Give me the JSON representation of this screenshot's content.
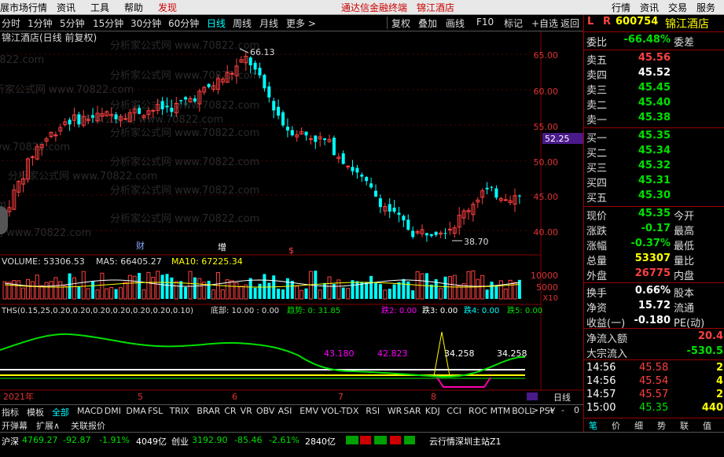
{
  "menubar": {
    "items": [
      "展市场行情",
      "资讯",
      "工具",
      "帮助",
      "发现"
    ],
    "center_red": "通达信金融终端",
    "center_stock": "锦江酒店",
    "right": [
      "行情",
      "资讯",
      "交易",
      "服务"
    ]
  },
  "periods": {
    "items": [
      "分时",
      "1分钟",
      "5分钟",
      "15分钟",
      "30分钟",
      "60分钟",
      "日线",
      "周线",
      "月线",
      "更多 >"
    ],
    "active": "日线"
  },
  "toolbar": {
    "items": [
      "复权",
      "叠加",
      "画线",
      "F10",
      "标记",
      "+自选",
      "返回"
    ]
  },
  "main": {
    "title": "锦江酒店(日线 前复权)",
    "price_axis": [
      "65.00",
      "60.00",
      "55.00",
      "50.00",
      "45.00",
      "40.00"
    ],
    "current_tag": "52.25",
    "high_label": "66.13",
    "low_label": "38.70",
    "events": [
      "财",
      "增",
      "$"
    ],
    "watermark": "分析家公式网 www.70822.com"
  },
  "volume": {
    "label": "VOLUME: 53306.53",
    "ma5": "MA5: 66405.27",
    "ma10": "MA10: 67225.34",
    "axis": [
      "10000",
      "5000"
    ],
    "x10": "X10"
  },
  "ths": {
    "label": "THS(0.15,25,0.20,0.20,0.20,0.20,0.20,0.20,0.10)",
    "bottom": "底部: 10.00 : 0.00",
    "trend": "趋势: 0: 31.85",
    "fall2": "跌2: 0.00",
    "fall3": "跌3: 0.00",
    "fall4": "跌4: 0.00",
    "fall5": "跌5: 0.00",
    "values": [
      "43.180",
      "42.823",
      "34.258",
      "34.258"
    ]
  },
  "timeaxis": {
    "labels": [
      "2021年",
      "5",
      "6",
      "7",
      "8"
    ],
    "period": "日线"
  },
  "tabs": {
    "items": [
      "指标",
      "模板",
      "全部",
      "MACD",
      "DMI",
      "DMA",
      "FSL",
      "TRIX",
      "BRAR",
      "CR",
      "VR",
      "OBV",
      "ASI",
      "EMV",
      "VOL-TDX",
      "RSI",
      "WR",
      "SAR",
      "KDJ",
      "CCI",
      "ROC",
      "MTM",
      "BOLL",
      "PSY"
    ],
    "active": "全部",
    "row2": [
      "开弹幕",
      "扩展∧",
      "关联报价"
    ],
    "controls": [
      ">",
      "+",
      "-",
      "0"
    ]
  },
  "quote": {
    "code": "600754",
    "name": "锦江酒店",
    "rating_label": "委比",
    "rating": "-66.48%",
    "diff_label": "委差",
    "asks": [
      {
        "l": "卖五",
        "p": "45.56"
      },
      {
        "l": "卖四",
        "p": "45.52"
      },
      {
        "l": "卖三",
        "p": "45.45"
      },
      {
        "l": "卖二",
        "p": "45.40"
      },
      {
        "l": "卖一",
        "p": "45.38"
      }
    ],
    "bids": [
      {
        "l": "买一",
        "p": "45.35"
      },
      {
        "l": "买二",
        "p": "45.34"
      },
      {
        "l": "买三",
        "p": "45.32"
      },
      {
        "l": "买四",
        "p": "45.31"
      },
      {
        "l": "买五",
        "p": "45.30"
      }
    ],
    "stats": [
      {
        "l": "现价",
        "v": "45.35",
        "l2": "今开"
      },
      {
        "l": "涨跌",
        "v": "-0.17",
        "l2": "最高"
      },
      {
        "l": "涨幅",
        "v": "-0.37%",
        "l2": "最低"
      },
      {
        "l": "总量",
        "v": "53307",
        "l2": "量比"
      },
      {
        "l": "外盘",
        "v": "26775",
        "l2": "内盘"
      }
    ],
    "stats2": [
      {
        "l": "换手",
        "v": "0.66%",
        "l2": "股本"
      },
      {
        "l": "净资",
        "v": "15.72",
        "l2": "流通"
      },
      {
        "l": "收益(一)",
        "v": "-0.180",
        "l2": "PE(动)"
      }
    ],
    "flow": [
      {
        "l": "净流入额",
        "v": "20.4"
      },
      {
        "l": "大宗流入",
        "v": "-530.5"
      }
    ],
    "ticks": [
      {
        "t": "14:56",
        "p": "45.58",
        "v": "2"
      },
      {
        "t": "14:56",
        "p": "45.54",
        "v": "4"
      },
      {
        "t": "14:57",
        "p": "45.57",
        "v": "2"
      },
      {
        "t": "15:00",
        "p": "45.35",
        "v": "440"
      }
    ],
    "tabs": [
      "笔",
      "价",
      "细",
      "势",
      "联",
      "值"
    ]
  },
  "status": {
    "sh_label": "沪深",
    "sh": "4769.27",
    "sh_chg": "-92.87",
    "sh_pct": "-1.91%",
    "sh_amt": "4049亿",
    "cy_label": "创业",
    "cy": "3192.90",
    "cy_chg": "-85.46",
    "cy_pct": "-2.61%",
    "cy_amt": "2840亿",
    "server": "云行情深圳主站Z1"
  },
  "colors": {
    "up": "#ff4040",
    "down": "#00ffff",
    "bg": "#000000"
  },
  "chart_data": {
    "type": "candlestick",
    "high": 66.13,
    "low": 38.7,
    "ylim": [
      37,
      66
    ]
  }
}
